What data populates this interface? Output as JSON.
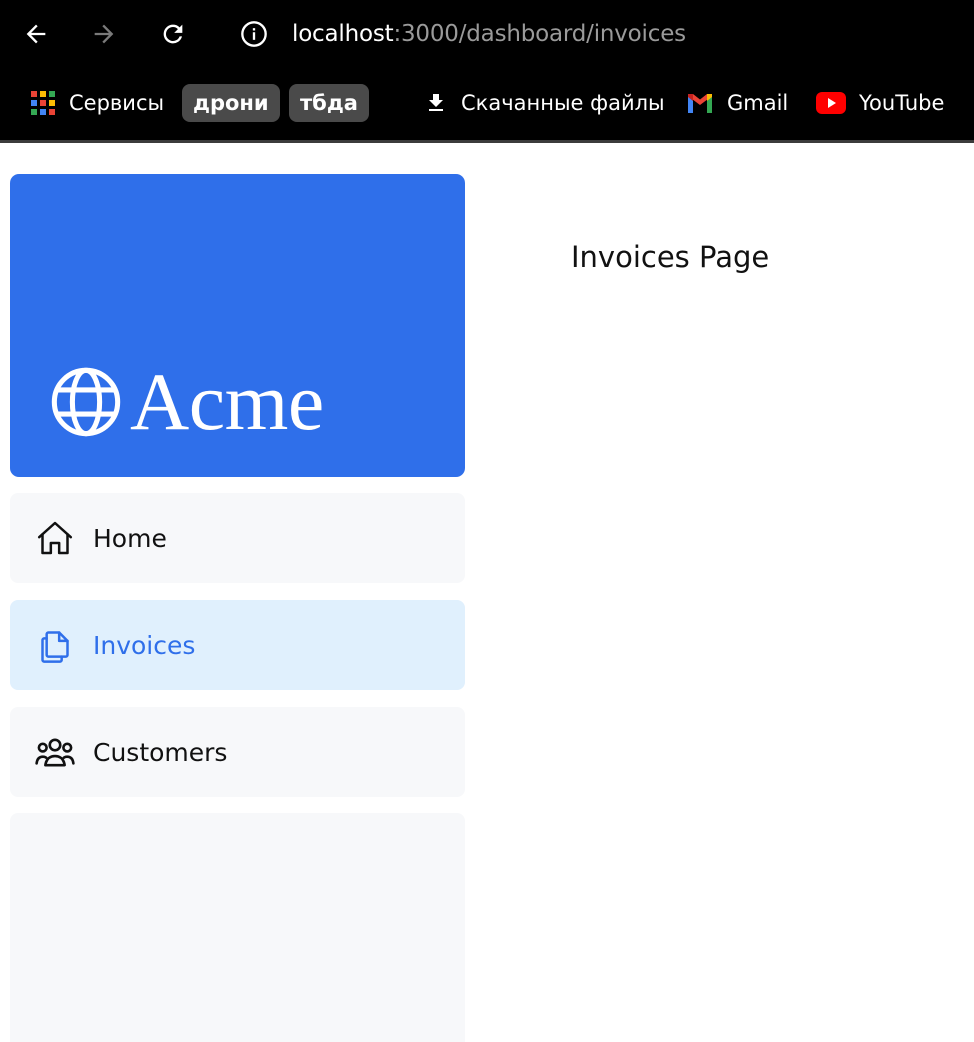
{
  "browser": {
    "url_host": "localhost",
    "url_path": ":3000/dashboard/invoices",
    "bookmarks": [
      {
        "label": "Сервисы",
        "icon": "apps-grid-icon"
      },
      {
        "label": "дрони",
        "icon": null
      },
      {
        "label": "тбда",
        "icon": null
      },
      {
        "label": "Скачанные файлы",
        "icon": "download-icon"
      },
      {
        "label": "Gmail",
        "icon": "gmail-icon"
      },
      {
        "label": "YouTube",
        "icon": "youtube-icon"
      }
    ]
  },
  "sidebar": {
    "logo_text": "Acme",
    "items": [
      {
        "label": "Home",
        "icon": "home-icon",
        "active": false
      },
      {
        "label": "Invoices",
        "icon": "document-duplicate-icon",
        "active": true
      },
      {
        "label": "Customers",
        "icon": "user-group-icon",
        "active": false
      }
    ]
  },
  "main": {
    "title": "Invoices Page"
  },
  "colors": {
    "brand_blue": "#2f6fea",
    "active_bg": "#e0f0fd",
    "nav_bg": "#f7f8fa"
  }
}
